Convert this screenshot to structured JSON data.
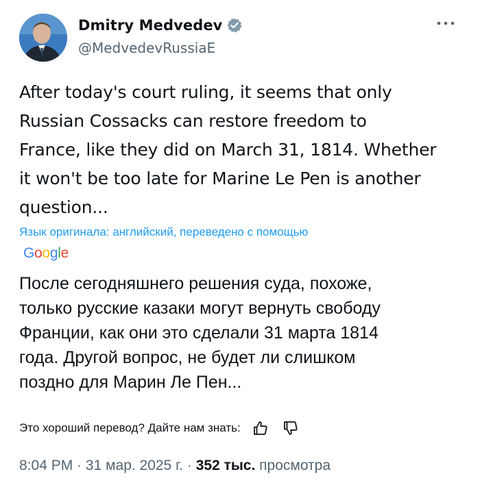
{
  "author": {
    "display_name": "Dmitry Medvedev",
    "handle": "@MedvedevRussiaE",
    "verified": true,
    "avatar": "avatar-photo"
  },
  "icons": {
    "verified": "verified-badge-icon",
    "more": "more-options-icon",
    "thumbs_up": "thumbs-up-icon",
    "thumbs_down": "thumbs-down-icon"
  },
  "tweet": {
    "text_lines": [
      "After today's court ruling, it seems that only",
      "Russian Cossacks can restore freedom to",
      "France, like they did on March 31, 1814. Whether",
      "it won't be too late for Marine Le Pen is another",
      "question..."
    ]
  },
  "translation": {
    "translated_by": "Язык оригинала: английский, переведено с помощью",
    "provider_letters": [
      "G",
      "o",
      "o",
      "g",
      "l",
      "e"
    ],
    "text_lines": [
      "После сегодняшнего решения суда, похоже,",
      "только русские казаки могут вернуть свободу",
      "Франции, как они это сделали 31 марта 1814",
      "года. Другой вопрос, не будет ли слишком",
      "поздно для Марин Ле Пен..."
    ],
    "feedback_prompt": "Это хороший перевод? Дайте нам знать:"
  },
  "meta": {
    "time": "8:04 PM",
    "separator": " · ",
    "date": "31 мар. 2025 г.",
    "views_count": "352 тыс.",
    "views_label": "просмотра"
  },
  "colors": {
    "text": "#0f1419",
    "secondary": "#536471",
    "link": "#1d9bf0",
    "verified": "#829aab",
    "google_blue": "#4285f4",
    "google_red": "#ea4335",
    "google_yellow": "#fbbc05",
    "google_green": "#34a853"
  }
}
